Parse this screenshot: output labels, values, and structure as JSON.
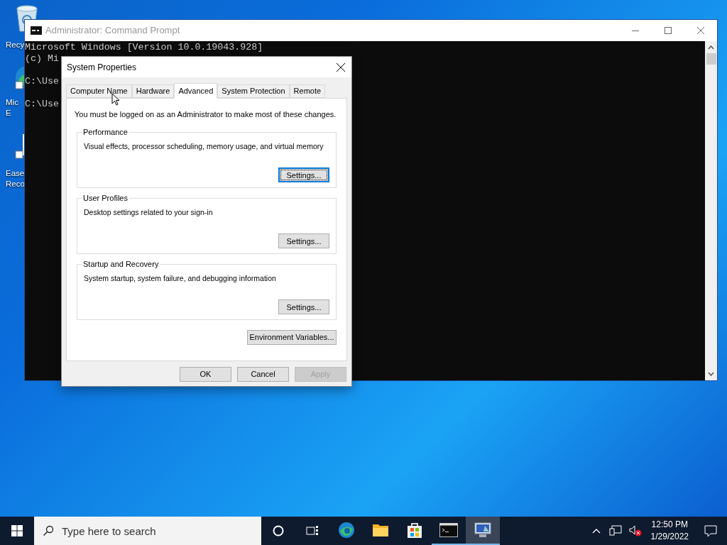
{
  "desktop_icons": [
    {
      "kind": "recycle",
      "label": [
        "Recy"
      ]
    },
    {
      "kind": "edge",
      "label": [
        "Mic",
        "E"
      ]
    },
    {
      "kind": "app",
      "label": [
        "Ease",
        "Reco"
      ]
    }
  ],
  "console": {
    "title": "Administrator: Command Prompt",
    "blocks": [
      [
        "Microsoft Windows [Version 10.0.19043.928]",
        "(c) Mi"
      ],
      [
        "C:\\Use"
      ],
      [
        "C:\\Use"
      ]
    ]
  },
  "dialog": {
    "title": "System Properties",
    "tabs": [
      {
        "label": "Computer Name",
        "selected": false
      },
      {
        "label": "Hardware",
        "selected": false
      },
      {
        "label": "Advanced",
        "selected": true
      },
      {
        "label": "System Protection",
        "selected": false
      },
      {
        "label": "Remote",
        "selected": false
      }
    ],
    "notice": "You must be logged on as an Administrator to make most of these changes.",
    "groups": [
      {
        "title": "Performance",
        "description": "Visual effects, processor scheduling, memory usage, and virtual memory",
        "button": {
          "label": "Settings...",
          "focused": true
        }
      },
      {
        "title": "User Profiles",
        "description": "Desktop settings related to your sign-in",
        "button": {
          "label": "Settings...",
          "focused": false
        }
      },
      {
        "title": "Startup and Recovery",
        "description": "System startup, system failure, and debugging information",
        "button": {
          "label": "Settings...",
          "focused": false
        }
      }
    ],
    "env_button": "Environment Variables...",
    "buttons": [
      {
        "label": "OK",
        "disabled": false
      },
      {
        "label": "Cancel",
        "disabled": false
      },
      {
        "label": "Apply",
        "disabled": true
      }
    ]
  },
  "taskbar": {
    "search_placeholder": "Type here to search",
    "apps": [
      {
        "kind": "edge",
        "running": false,
        "selected": false
      },
      {
        "kind": "folder",
        "running": false,
        "selected": false
      },
      {
        "kind": "store",
        "running": false,
        "selected": false
      },
      {
        "kind": "cmd",
        "running": true,
        "selected": false
      },
      {
        "kind": "sysprops",
        "running": true,
        "selected": true
      }
    ],
    "time": "12:50 PM",
    "date": "1/29/2022"
  }
}
